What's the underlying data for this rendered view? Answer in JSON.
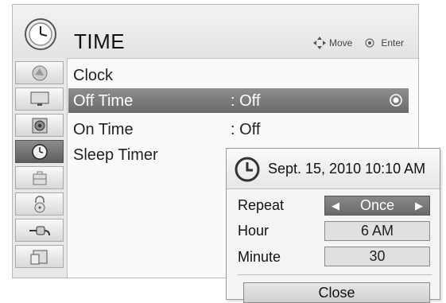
{
  "header": {
    "title": "TIME",
    "move_label": "Move",
    "enter_label": "Enter"
  },
  "sidebar": {
    "items": [
      {
        "icon": "satellite-dish-icon"
      },
      {
        "icon": "monitor-icon"
      },
      {
        "icon": "speaker-icon"
      },
      {
        "icon": "clock-icon",
        "active": true
      },
      {
        "icon": "toolbox-icon"
      },
      {
        "icon": "lock-icon"
      },
      {
        "icon": "plug-icon"
      },
      {
        "icon": "input-icon"
      }
    ]
  },
  "menu": {
    "items": [
      {
        "label": "Clock",
        "value": ""
      },
      {
        "label": "Off Time",
        "value": ": Off",
        "selected": true
      },
      {
        "label": "On Time",
        "value": ": Off"
      },
      {
        "label": "Sleep Timer",
        "value": ""
      }
    ]
  },
  "popup": {
    "date": "Sept. 15, 2010  10:10 AM",
    "repeat_label": "Repeat",
    "repeat_value": "Once",
    "hour_label": "Hour",
    "hour_value": "6 AM",
    "minute_label": "Minute",
    "minute_value": "30",
    "close_label": "Close"
  },
  "colors": {
    "selected_bg": "#7a7a7a",
    "panel_bg": "#fafafa"
  }
}
